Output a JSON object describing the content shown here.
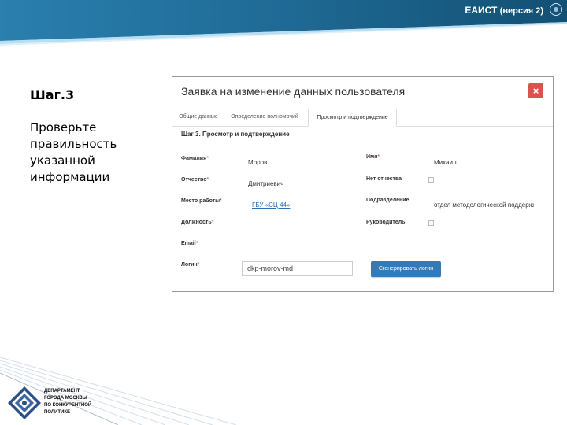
{
  "header": {
    "title": "ЕАИСТ",
    "version": "(версия 2)"
  },
  "instruction": {
    "step": "Шаг.3",
    "text": "Проверьте правильность указанной информации"
  },
  "modal": {
    "title": "Заявка на изменение данных пользователя",
    "close_label": "×",
    "tabs": [
      {
        "label": "Общие данные"
      },
      {
        "label": "Определение полномочий"
      },
      {
        "label": "Просмотр и подтверждение"
      }
    ],
    "section_title": "Шаг 3. Просмотр и подтверждение",
    "fields": {
      "last_name": {
        "label": "Фамилия",
        "required": "*",
        "value": "Моров"
      },
      "first_name": {
        "label": "Имя",
        "required": "*",
        "value": "Михаил"
      },
      "patronymic": {
        "label": "Отчество",
        "required": "*",
        "value": "Дмитриевич"
      },
      "no_patronymic": {
        "label": "Нет отчества"
      },
      "workplace": {
        "label": "Место работы",
        "required": "*",
        "value": "ГБУ «СЦ 44»"
      },
      "department": {
        "label": "Подразделение",
        "value": "отдел методологической поддержки"
      },
      "position": {
        "label": "Должность",
        "required": "*"
      },
      "manager": {
        "label": "Руководитель"
      },
      "email": {
        "label": "Email",
        "required": "*"
      },
      "login": {
        "label": "Логин",
        "required": "*",
        "value": "dkp-morov-md"
      }
    },
    "generate_button": "Сгенерировать логин"
  },
  "footer": {
    "dept_lines": [
      "ДЕПАРТАМЕНТ",
      "ГОРОДА МОСКВЫ",
      "ПО КОНКУРЕНТНОЙ",
      "ПОЛИТИКЕ"
    ]
  },
  "colors": {
    "header_dark": "#1c5f86",
    "header_light": "#6fb3d8",
    "accent_button": "#337ab7",
    "close_button": "#d9534f"
  }
}
